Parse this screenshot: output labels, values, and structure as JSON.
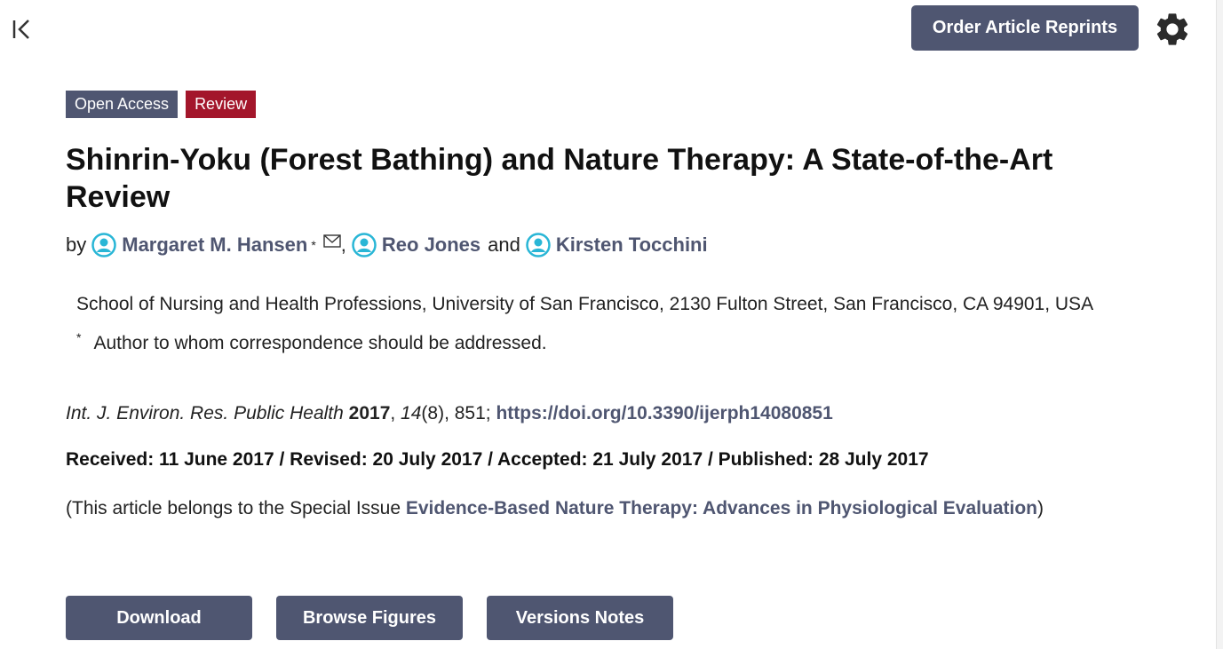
{
  "header": {
    "reprints_label": "Order Article Reprints"
  },
  "icons": {
    "collapse": "collapse-left-icon",
    "settings": "gear-icon",
    "author": "author-profile-icon",
    "mail": "envelope-icon"
  },
  "colors": {
    "primary": "#4f5671",
    "review_badge": "#a3162b",
    "author_icon": "#29b6d6"
  },
  "article": {
    "badges": [
      "Open Access",
      "Review"
    ],
    "title": "Shinrin-Yoku (Forest Bathing) and Nature Therapy: A State-of-the-Art Review",
    "by": "by",
    "authors": [
      {
        "name": "Margaret M. Hansen",
        "marker": "*"
      },
      {
        "name": "Reo Jones"
      },
      {
        "name": "Kirsten Tocchini"
      }
    ],
    "author_separator_1": ",",
    "author_conjunction": "and",
    "affiliation": "School of Nursing and Health Professions, University of San Francisco, 2130 Fulton Street, San Francisco, CA 94901, USA",
    "correspondence_marker": "*",
    "correspondence_note": "Author to whom correspondence should be addressed.",
    "citation": {
      "journal": "Int. J. Environ. Res. Public Health",
      "year": "2017",
      "volume": "14",
      "issue": "(8)",
      "pages": ", 851;",
      "doi": "https://doi.org/10.3390/ijerph14080851"
    },
    "dates": "Received: 11 June 2017 / Revised: 20 July 2017 / Accepted: 21 July 2017 / Published: 28 July 2017",
    "special_issue": {
      "prefix": "(This article belongs to the Special Issue",
      "name": "Evidence-Based Nature Therapy: Advances in Physiological Evaluation",
      "suffix": ")"
    }
  },
  "actions": {
    "download": "Download",
    "browse_figures": "Browse Figures",
    "versions_notes": "Versions Notes"
  }
}
